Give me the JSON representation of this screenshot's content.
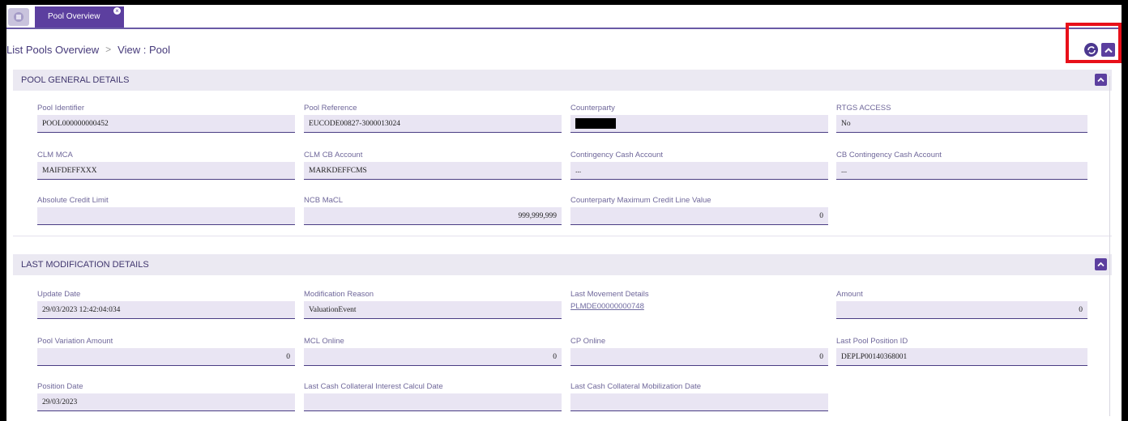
{
  "tabs": {
    "home_icon": "home-icon",
    "active_label": "Pool Overview"
  },
  "breadcrumb": {
    "parent": "List Pools Overview",
    "separator": ">",
    "current": "View : Pool"
  },
  "colors": {
    "accent": "#5c3f9f",
    "highlight": "#e8101a"
  },
  "general": {
    "title": "POOL GENERAL DETAILS",
    "pool_identifier": {
      "label": "Pool Identifier",
      "value": "POOL000000000452"
    },
    "pool_reference": {
      "label": "Pool Reference",
      "value": "EUCODE00827-3000013024"
    },
    "counterparty": {
      "label": "Counterparty",
      "value": ""
    },
    "rtgs_access": {
      "label": "RTGS ACCESS",
      "value": "No"
    },
    "clm_mca": {
      "label": "CLM MCA",
      "value": "MAIFDEFFXXX"
    },
    "clm_cb_account": {
      "label": "CLM CB Account",
      "value": "MARKDEFFCMS"
    },
    "contingency_cash": {
      "label": "Contingency Cash Account",
      "value": "..."
    },
    "cb_contingency_cash": {
      "label": "CB Contingency Cash Account",
      "value": "..."
    },
    "absolute_credit_limit": {
      "label": "Absolute Credit Limit",
      "value": ""
    },
    "ncb_macl": {
      "label": "NCB MaCL",
      "value": "999,999,999"
    },
    "cp_max_credit_line": {
      "label": "Counterparty Maximum Credit Line Value",
      "value": "0"
    }
  },
  "modification": {
    "title": "LAST MODIFICATION DETAILS",
    "update_date": {
      "label": "Update Date",
      "value": "29/03/2023 12:42:04:034"
    },
    "modification_reason": {
      "label": "Modification Reason",
      "value": "ValuationEvent"
    },
    "last_movement": {
      "label": "Last Movement Details",
      "value": "PLMDE00000000748"
    },
    "amount": {
      "label": "Amount",
      "value": "0"
    },
    "pool_variation_amount": {
      "label": "Pool Variation Amount",
      "value": "0"
    },
    "mcl_online": {
      "label": "MCL Online",
      "value": "0"
    },
    "cp_online": {
      "label": "CP Online",
      "value": "0"
    },
    "last_pool_position_id": {
      "label": "Last Pool Position ID",
      "value": "DEPLP00140368001"
    },
    "position_date": {
      "label": "Position Date",
      "value": "29/03/2023"
    },
    "last_cash_interest": {
      "label": "Last Cash Collateral Interest Calcul Date",
      "value": ""
    },
    "last_cash_mobilization": {
      "label": "Last Cash Collateral Mobilization Date",
      "value": ""
    }
  }
}
